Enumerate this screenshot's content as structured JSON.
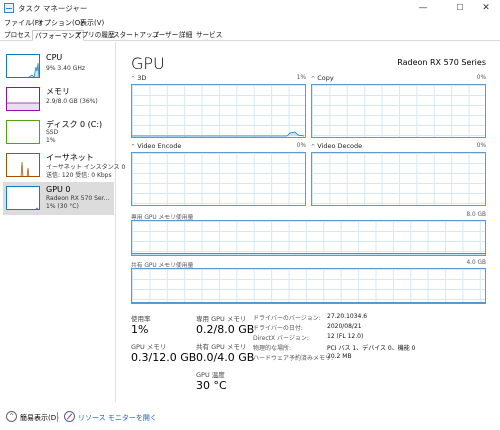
{
  "window": {
    "title": "タスク マネージャー",
    "min_glyph": "—",
    "max_glyph": "☐",
    "close_glyph": "✕"
  },
  "menu": [
    "ファイル(F)",
    "オプション(O)",
    "表示(V)"
  ],
  "tabs": [
    "プロセス",
    "パフォーマンス",
    "アプリの履歴",
    "スタートアップ",
    "ユーザー",
    "詳細",
    "サービス"
  ],
  "active_tab": "パフォーマンス",
  "sidebar": [
    {
      "name": "CPU",
      "sub": [
        "9%  3.40 GHz"
      ],
      "color": "#117dbb"
    },
    {
      "name": "メモリ",
      "sub": [
        "2.9/8.0 GB (36%)"
      ],
      "color": "#8b12ae"
    },
    {
      "name": "ディスク 0 (C:)",
      "sub": [
        "SSD",
        "1%"
      ],
      "color": "#4da60c"
    },
    {
      "name": "イーサネット",
      "sub": [
        "イーサネット インスタンス 0",
        "送信: 120  受信: 0 Kbps"
      ],
      "color": "#a74f01"
    },
    {
      "name": "GPU 0",
      "sub": [
        "Radeon RX 570 Ser...",
        "1% (30 °C)"
      ],
      "color": "#117dbb"
    }
  ],
  "main": {
    "title": "GPU",
    "model": "Radeon RX 570 Series",
    "graphs": [
      {
        "name": "3D",
        "pct": "1%"
      },
      {
        "name": "Copy",
        "pct": "0%"
      },
      {
        "name": "Video Encode",
        "pct": "0%"
      },
      {
        "name": "Video Decode",
        "pct": "0%"
      }
    ],
    "dedicated_label": "専用 GPU メモリ使用量",
    "dedicated_max": "8.0 GB",
    "shared_label": "共有 GPU メモリ使用量",
    "shared_max": "4.0 GB",
    "stats": {
      "usage_label": "使用率",
      "usage_value": "1%",
      "gpu_mem_label": "GPU メモリ",
      "gpu_mem_value": "0.3/12.0 GB",
      "ded_mem_label": "専用 GPU メモリ",
      "ded_mem_value": "0.2/8.0 GB",
      "shared_mem_label": "共有 GPU メモリ",
      "shared_mem_value": "0.0/4.0 GB",
      "temp_label": "GPU 温度",
      "temp_value": "30 °C"
    },
    "info": [
      {
        "k": "ドライバーのバージョン:",
        "v": "27.20.1034.6"
      },
      {
        "k": "ドライバーの日付:",
        "v": "2020/08/21"
      },
      {
        "k": "DirectX バージョン:",
        "v": "12 (FL 12.0)"
      },
      {
        "k": "物理的な場所:",
        "v": "PCI バス 1、デバイス 0、機能 0"
      },
      {
        "k": "ハードウェア予約済みメモリ:",
        "v": "20.2 MB"
      }
    ]
  },
  "bottom": {
    "fewer_label": "簡易表示(D)",
    "resmon_label": "リソース モニターを開く"
  },
  "icons": {
    "caret": "^",
    "fewer": "^"
  }
}
